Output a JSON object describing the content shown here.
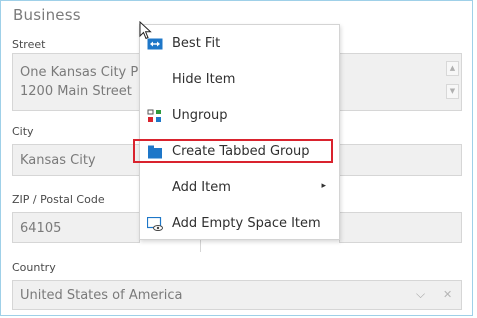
{
  "group": {
    "title": "Business"
  },
  "fields": {
    "street": {
      "label": "Street",
      "line1": "One Kansas City Pla",
      "line2": "1200 Main Street"
    },
    "city": {
      "label": "City",
      "value": "Kansas City"
    },
    "zip": {
      "label": "ZIP / Postal Code",
      "value": "64105"
    },
    "country": {
      "label": "Country",
      "value": "United States of America"
    }
  },
  "context_menu": {
    "items": [
      {
        "label": "Best Fit",
        "icon": "best-fit-icon"
      },
      {
        "label": "Hide Item",
        "icon": ""
      },
      {
        "label": "Ungroup",
        "icon": "ungroup-icon"
      },
      {
        "label": "Create Tabbed Group",
        "icon": "tabbed-group-icon",
        "highlighted": true
      },
      {
        "label": "Add Item",
        "icon": "",
        "submenu": true
      },
      {
        "label": "Add Empty Space Item",
        "icon": "empty-space-icon"
      }
    ],
    "submenu_arrow": "▸"
  },
  "colors": {
    "frame_border": "#9fd0e8",
    "highlight_border": "#d9232e",
    "icon_blue": "#1e77c8"
  }
}
